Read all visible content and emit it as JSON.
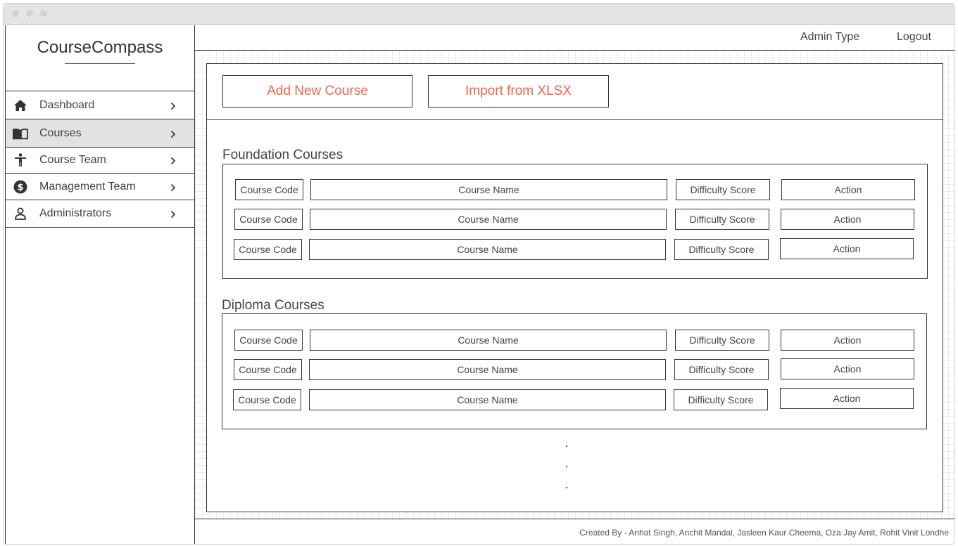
{
  "app": {
    "brand": "CourseCompass"
  },
  "sidebar": {
    "items": [
      {
        "label": "Dashboard",
        "icon": "home-icon",
        "active": false
      },
      {
        "label": "Courses",
        "icon": "book-icon",
        "active": true
      },
      {
        "label": "Course Team",
        "icon": "person-icon",
        "active": false
      },
      {
        "label": "Management Team",
        "icon": "dollar-icon",
        "active": false
      },
      {
        "label": "Administrators",
        "icon": "user-icon",
        "active": false
      }
    ]
  },
  "topbar": {
    "admin_type": "Admin Type",
    "logout": "Logout"
  },
  "actions": {
    "add_course": "Add New Course",
    "import_xlsx": "Import from XLSX"
  },
  "sections": [
    {
      "title": "Foundation Courses",
      "columns": [
        "Course Code",
        "Course Name",
        "Difficulty Score",
        "Action"
      ],
      "rows": [
        [
          "Course Code",
          "Course Name",
          "Difficulty Score",
          "Action"
        ],
        [
          "Course Code",
          "Course Name",
          "Difficulty Score",
          "Action"
        ],
        [
          "Course Code",
          "Course Name",
          "Difficulty Score",
          "Action"
        ]
      ]
    },
    {
      "title": "Diploma Courses",
      "columns": [
        "Course Code",
        "Course Name",
        "Difficulty Score",
        "Action"
      ],
      "rows": [
        [
          "Course Code",
          "Course Name",
          "Difficulty Score",
          "Action"
        ],
        [
          "Course Code",
          "Course Name",
          "Difficulty Score",
          "Action"
        ],
        [
          "Course Code",
          "Course Name",
          "Difficulty Score",
          "Action"
        ]
      ]
    }
  ],
  "more_indicator": [
    ".",
    ".",
    "."
  ],
  "footer": {
    "credits": "Created By - Anhat Singh, Anchit Mandal, Jasleen Kaur Cheema, Oza Jay Amit, Rohit Vinit Londhe"
  },
  "colors": {
    "accent": "#f2634b",
    "active_nav": "#e2e2e2",
    "border": "#333333"
  }
}
